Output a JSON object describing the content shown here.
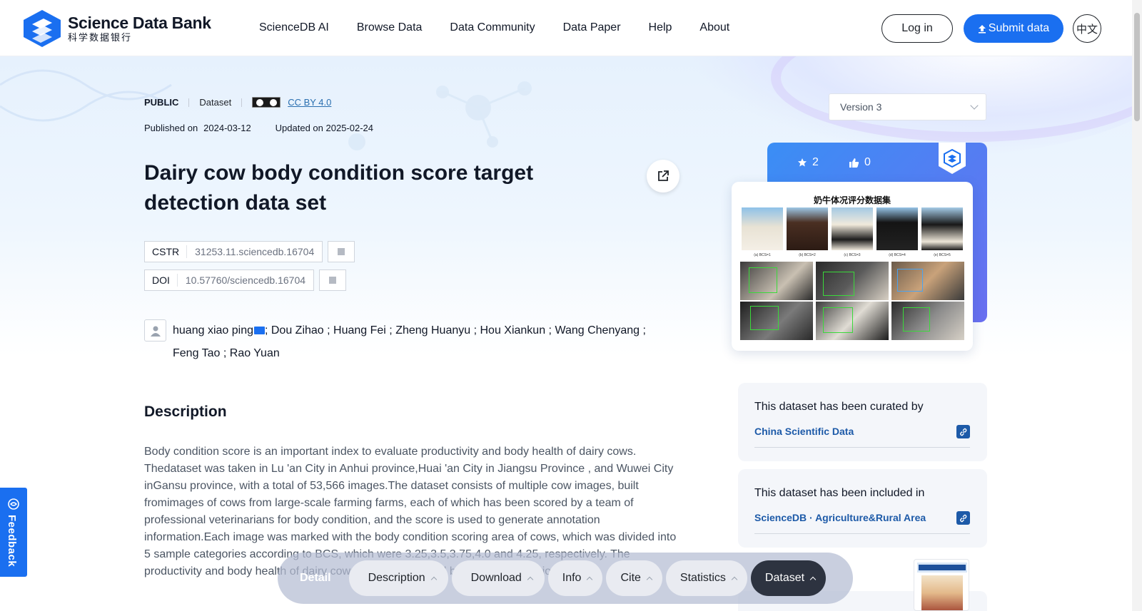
{
  "header": {
    "logo_en": "Science Data Bank",
    "logo_cn": "科学数据银行",
    "nav": [
      {
        "label": "ScienceDB AI"
      },
      {
        "label": "Browse Data"
      },
      {
        "label": "Data Community"
      },
      {
        "label": "Data Paper"
      },
      {
        "label": "Help"
      },
      {
        "label": "About"
      }
    ],
    "login": "Log in",
    "submit": "Submit data",
    "lang": "中文"
  },
  "meta": {
    "visibility": "PUBLIC",
    "type": "Dataset",
    "license": "CC BY 4.0",
    "published_label": "Published on",
    "published_date": "2024-03-12",
    "updated": "Updated on 2025-02-24"
  },
  "title": "Dairy cow body condition score target detection data set",
  "identifiers": [
    {
      "key": "CSTR",
      "value": "31253.11.sciencedb.16704"
    },
    {
      "key": "DOI",
      "value": "10.57760/sciencedb.16704"
    }
  ],
  "authors": {
    "first": "huang xiao ping",
    "rest": "; Dou Zihao ; Huang Fei ; Zheng Huanyu ; Hou Xiankun ; Wang Chenyang ; Feng Tao ; Rao Yuan"
  },
  "description": {
    "heading": "Description",
    "text": "Body condition score is an important index to evaluate productivity and body health of dairy cows. Thedataset was taken in Lu 'an City in Anhui province,Huai 'an City in Jiangsu Province , and Wuwei City inGansu province, with a total of 53,566 images.The dataset consists of multiple cow images, built fromimages of cows from large-scale farming farms, each of which has been scored by a team of professional veterinarians for body condition, and the score is used to generate annotation information.Each image was marked with the body condition scoring area of cows, which was divided into 5 sample categories according to BCS, which were 3.25,3.5,3.75,4.0 and 4.25, respectively. The productivity and body health of dairy cows can be evaluated by the body condition score."
  },
  "sidebar": {
    "version": "Version 3",
    "stars": "2",
    "likes": "0",
    "thumbnail_title": "奶牛体况评分数据集",
    "thumbnail_captions": [
      "(a) BCS=1",
      "(b) BCS=2",
      "(c) BCS=3",
      "(d) BCS=4",
      "(e) BCS=5"
    ],
    "curated_label": "This dataset has been curated by",
    "curated_by": "China Scientific Data",
    "included_label": "This dataset has been included in",
    "included_in": "ScienceDB · Agriculture&Rural Area"
  },
  "feedback": "Feedback",
  "bottom_nav": {
    "detail": "Detail",
    "tabs": [
      {
        "label": "Description"
      },
      {
        "label": "Download"
      },
      {
        "label": "Info"
      },
      {
        "label": "Cite"
      },
      {
        "label": "Statistics"
      },
      {
        "label": "Dataset"
      }
    ]
  },
  "colors": {
    "brand": "#1a6ff0",
    "link": "#1d5aa8",
    "active_tab": "#2d3340"
  }
}
